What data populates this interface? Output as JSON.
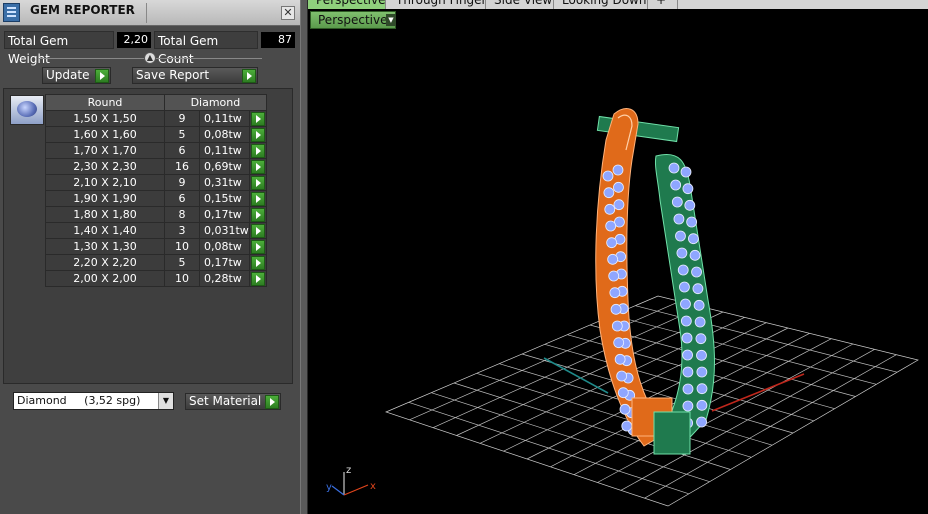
{
  "panel": {
    "title": "GEM REPORTER",
    "close_icon": "close-icon",
    "total_weight_label": "Total Gem Weight",
    "total_weight_value": "2,20",
    "total_count_label": "Total Gem Count",
    "total_count_value": "87",
    "update_label": "Update",
    "save_report_label": "Save Report",
    "table": {
      "headers": [
        "Round",
        "Diamond"
      ],
      "rows": [
        {
          "size": "1,50 X 1,50",
          "count": "9",
          "weight": "0,11tw"
        },
        {
          "size": "1,60 X 1,60",
          "count": "5",
          "weight": "0,08tw"
        },
        {
          "size": "1,70 X 1,70",
          "count": "6",
          "weight": "0,11tw"
        },
        {
          "size": "2,30 X 2,30",
          "count": "16",
          "weight": "0,69tw"
        },
        {
          "size": "2,10 X 2,10",
          "count": "9",
          "weight": "0,31tw"
        },
        {
          "size": "1,90 X 1,90",
          "count": "6",
          "weight": "0,15tw"
        },
        {
          "size": "1,80 X 1,80",
          "count": "8",
          "weight": "0,17tw"
        },
        {
          "size": "1,40 X 1,40",
          "count": "3",
          "weight": "0,031tw"
        },
        {
          "size": "1,30 X 1,30",
          "count": "10",
          "weight": "0,08tw"
        },
        {
          "size": "2,20 X 2,20",
          "count": "5",
          "weight": "0,17tw"
        },
        {
          "size": "2,00 X 2,00",
          "count": "10",
          "weight": "0,28tw"
        }
      ]
    },
    "material_value": "Diamond     (3,52 spg)",
    "set_material_label": "Set Material"
  },
  "viewport": {
    "tabs": [
      "Perspective",
      "Through Finger",
      "Side View",
      "Looking Down",
      "+"
    ],
    "view_mode": "Perspective",
    "axis": {
      "x": "x",
      "y": "y",
      "z": "z"
    }
  },
  "colors": {
    "panel_bg": "#4a4a4a",
    "accent_green": "#3c9a2e",
    "ring_orange": "#e06a1a",
    "ring_green": "#1f7a4e",
    "gem_blue": "#8fa6ff"
  }
}
